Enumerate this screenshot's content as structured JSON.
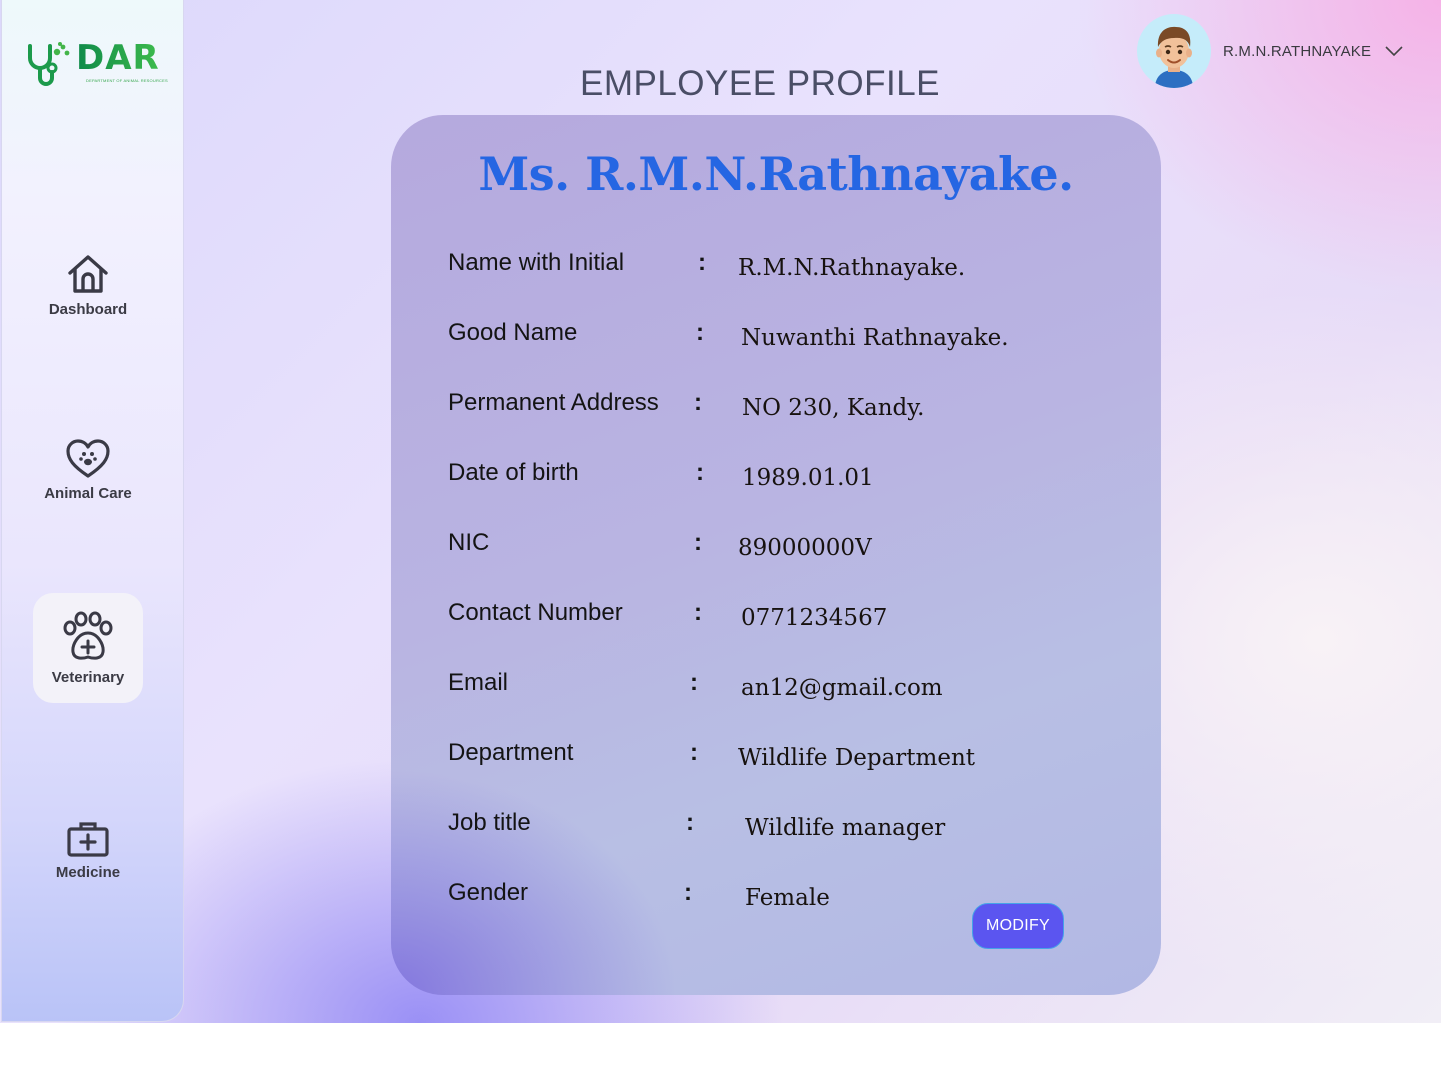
{
  "brand": {
    "name": "DAR",
    "subtitle": "DEPARTMENT OF ANIMAL RESOURCES"
  },
  "sidebar": {
    "items": [
      {
        "label": "Dashboard",
        "icon": "home-icon",
        "active": false
      },
      {
        "label": "Animal Care",
        "icon": "heart-paw-icon",
        "active": false
      },
      {
        "label": "Veterinary",
        "icon": "paw-plus-icon",
        "active": true
      },
      {
        "label": "Medicine",
        "icon": "medical-kit-icon",
        "active": false
      }
    ]
  },
  "header": {
    "title": "EMPLOYEE PROFILE",
    "user_name": "R.M.N.RATHNAYAKE"
  },
  "profile": {
    "heading": "Ms. R.M.N.Rathnayake.",
    "fields": [
      {
        "label": "Name with Initial",
        "value": "R.M.N.Rathnayake."
      },
      {
        "label": "Good Name",
        "value": "Nuwanthi Rathnayake."
      },
      {
        "label": "Permanent Address",
        "value": "NO 230, Kandy."
      },
      {
        "label": "Date of birth",
        "value": "1989.01.01"
      },
      {
        "label": "NIC",
        "value": "89000000V"
      },
      {
        "label": "Contact Number",
        "value": "0771234567"
      },
      {
        "label": "Email",
        "value": "an12@gmail.com"
      },
      {
        "label": "Department",
        "value": "Wildlife Department"
      },
      {
        "label": "Job title",
        "value": "Wildlife manager"
      },
      {
        "label": "Gender",
        "value": "Female"
      }
    ],
    "separator": ":",
    "modify_label": "MODIFY"
  },
  "colors": {
    "heading": "#2566e3",
    "button": "#5b55f0",
    "brand_green": "#1c9a4b"
  }
}
